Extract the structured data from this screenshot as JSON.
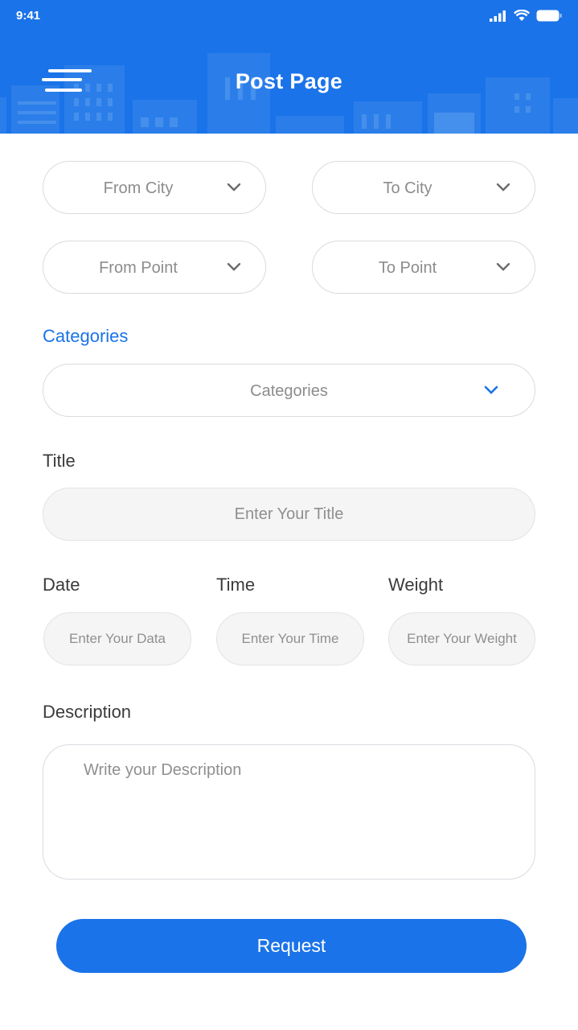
{
  "status_bar": {
    "time": "9:41"
  },
  "header": {
    "title": "Post Page"
  },
  "form": {
    "from_city": "From City",
    "to_city": "To City",
    "from_point": "From Point",
    "to_point": "To Point",
    "categories_heading": "Categories",
    "categories_select": "Categories",
    "title_label": "Title",
    "title_placeholder": "Enter Your Title",
    "date_label": "Date",
    "date_placeholder": "Enter Your Data",
    "time_label": "Time",
    "time_placeholder": "Enter Your Time",
    "weight_label": "Weight",
    "weight_placeholder": "Enter Your Weight",
    "description_label": "Description",
    "description_placeholder": "Write your Description"
  },
  "actions": {
    "request_label": "Request"
  },
  "colors": {
    "primary": "#1a73e8",
    "field_fill": "#f5f5f5",
    "border": "#d9dbe0"
  },
  "icons": [
    "hamburger-menu-icon",
    "chevron-down-icon",
    "signal-icon",
    "wifi-icon",
    "battery-icon"
  ]
}
